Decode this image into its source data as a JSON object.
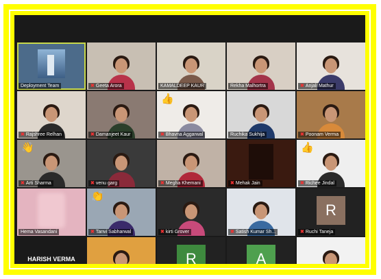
{
  "meeting": {
    "participants": [
      {
        "name": "Deployment Team",
        "muted": false,
        "active": true,
        "scene": "building",
        "bg": "#4c6b8a"
      },
      {
        "name": "Geeta Arora",
        "muted": true,
        "scene": "person",
        "bg": "#c8bfb3",
        "shirt": "#b8324a"
      },
      {
        "name": "KAMALDEEP KAUR",
        "muted": false,
        "scene": "person",
        "bg": "#d9d3c7",
        "shirt": "#7a5a4a"
      },
      {
        "name": "Rekha Malhortra",
        "muted": false,
        "scene": "person",
        "bg": "#d8cfc4",
        "shirt": "#a3344a"
      },
      {
        "name": "Anjali Mathur",
        "muted": true,
        "scene": "person",
        "bg": "#e7e2dc",
        "shirt": "#3b3b6a"
      },
      {
        "name": "Rajshree Relhan",
        "muted": true,
        "scene": "person",
        "bg": "#ded6cc",
        "shirt": "#2a2a2a"
      },
      {
        "name": "Damanjeet Kaur",
        "muted": true,
        "scene": "person",
        "bg": "#8a7a72",
        "shirt": "#2b3f2b"
      },
      {
        "name": "Bhavna Aggarwal",
        "muted": true,
        "scene": "person",
        "bg": "#efece8",
        "shirt": "#8a8aa0",
        "reaction": "👍"
      },
      {
        "name": "Ruchika Sukhija",
        "muted": false,
        "scene": "person",
        "bg": "#d8d8d8",
        "shirt": "#1f3a6a"
      },
      {
        "name": "Poonam Verma",
        "muted": true,
        "scene": "person",
        "bg": "#a87a4a",
        "shirt": "#d88a3a"
      },
      {
        "name": "Arti Sharma",
        "muted": true,
        "scene": "person",
        "bg": "#9a958e",
        "shirt": "#2a2a2a",
        "reaction": "👋"
      },
      {
        "name": "venu garg",
        "muted": true,
        "scene": "person",
        "bg": "#3a3a3a",
        "shirt": "#8a2a3a"
      },
      {
        "name": "Megha Khemani",
        "muted": true,
        "scene": "person",
        "bg": "#c0b2a6",
        "shirt": "#b0283a"
      },
      {
        "name": "Mehak Jain",
        "muted": true,
        "scene": "dark",
        "bg": "#3a1a10"
      },
      {
        "name": "Richee Jindal",
        "muted": true,
        "scene": "person",
        "bg": "#efefef",
        "shirt": "#2a2a2a",
        "reaction": "👍"
      },
      {
        "name": "Hema Vasandani",
        "muted": false,
        "scene": "blur",
        "bg": "#e4b4c0"
      },
      {
        "name": "Tanvi Sabharwal",
        "muted": true,
        "scene": "person",
        "bg": "#9aa7b4",
        "shirt": "#3a2a6a",
        "reaction": "👏"
      },
      {
        "name": "kirti Grover",
        "muted": true,
        "scene": "person",
        "bg": "#2a2a2a",
        "shirt": "#c84a7a"
      },
      {
        "name": "Satish Kumar Sh...",
        "muted": true,
        "scene": "person",
        "bg": "#e0e4ea",
        "shirt": "#3a6aa0"
      },
      {
        "name": "Ruchi Taneja",
        "muted": true,
        "scene": "letter",
        "letter": "R",
        "bg": "#8a7060"
      },
      {
        "name": "HARISH VERMA",
        "muted": false,
        "scene": "nameonly"
      },
      {
        "name": "",
        "muted": false,
        "scene": "person",
        "bg": "#e0a040",
        "shirt": "#1a2a3a"
      },
      {
        "name": "",
        "muted": false,
        "scene": "letter",
        "letter": "R",
        "bg": "#3e8a3e"
      },
      {
        "name": "",
        "muted": false,
        "scene": "letter",
        "letter": "A",
        "bg": "#4ea04e"
      },
      {
        "name": "",
        "muted": false,
        "scene": "person",
        "bg": "#f2f2f2",
        "shirt": "#c83a3a"
      }
    ]
  }
}
